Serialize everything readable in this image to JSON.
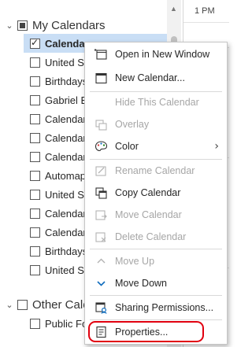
{
  "pane": {
    "my_calendars": "My Calendars",
    "other_calendars": "Other Cale",
    "calendars": [
      {
        "label": "Calendar",
        "checked": true,
        "selected": true
      },
      {
        "label": "United Sta",
        "checked": false
      },
      {
        "label": "Birthdays",
        "checked": false
      },
      {
        "label": "Gabriel B.",
        "checked": false
      },
      {
        "label": "Calendar",
        "checked": false
      },
      {
        "label": "Calendar",
        "checked": false
      },
      {
        "label": "Calendar",
        "checked": false
      },
      {
        "label": "Automapt",
        "checked": false
      },
      {
        "label": "United Sta",
        "checked": false
      },
      {
        "label": "Calendar",
        "checked": false
      },
      {
        "label": "Calendar",
        "checked": false
      },
      {
        "label": "Birthdays",
        "checked": false
      },
      {
        "label": "United Sta",
        "checked": false
      }
    ],
    "other_items": [
      {
        "label": "Public Fol",
        "checked": false
      }
    ]
  },
  "grid": {
    "time": "1 PM"
  },
  "menu": {
    "open_new_window": "Open in New Window",
    "new_calendar": "New Calendar...",
    "hide_calendar": "Hide This Calendar",
    "overlay": "Overlay",
    "color": "Color",
    "rename_calendar": "Rename Calendar",
    "copy_calendar": "Copy Calendar",
    "move_calendar": "Move Calendar",
    "delete_calendar": "Delete Calendar",
    "move_up": "Move Up",
    "move_down": "Move Down",
    "sharing_permissions": "Sharing Permissions...",
    "properties": "Properties..."
  },
  "colors": {
    "selection": "#c9def5",
    "accent": "#0f6cbd",
    "highlight_ring": "#e1000f",
    "disabled": "#a6a6a6"
  }
}
